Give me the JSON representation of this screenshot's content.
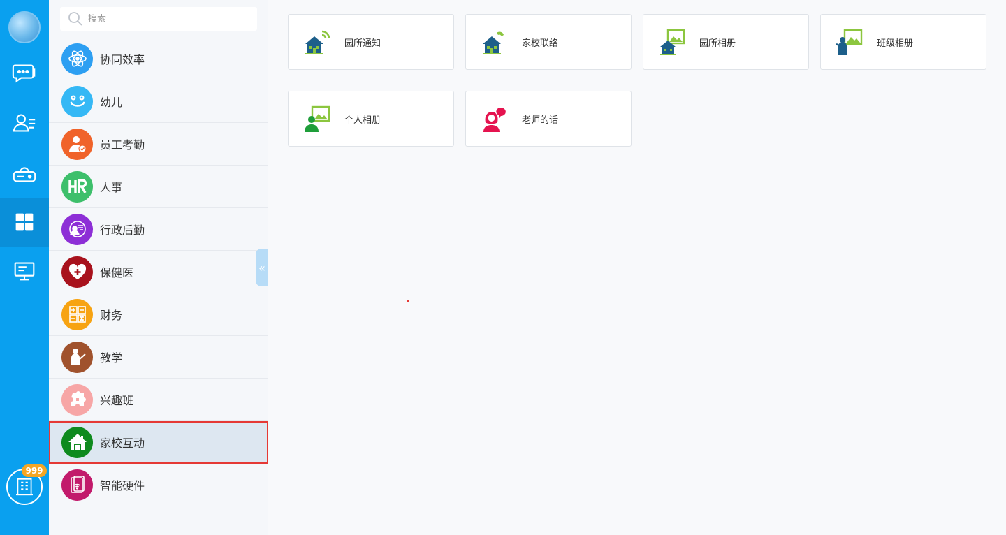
{
  "search": {
    "placeholder": "搜索"
  },
  "rail": {
    "badge": "999",
    "items": [
      {
        "name": "chat",
        "icon": "chat-bubbles-icon"
      },
      {
        "name": "contacts",
        "icon": "contacts-list-icon"
      },
      {
        "name": "cloud-disk",
        "icon": "cloud-drive-icon"
      },
      {
        "name": "apps",
        "icon": "app-grid-icon",
        "active": true
      },
      {
        "name": "display",
        "icon": "monitor-icon"
      }
    ]
  },
  "menu": {
    "items": [
      {
        "label": "协同效率",
        "icon": "atom-icon",
        "color": "#2d9ff2"
      },
      {
        "label": "幼儿",
        "icon": "smiley-face-icon",
        "color": "#35b8f5"
      },
      {
        "label": "员工考勤",
        "icon": "person-check-icon",
        "color": "#f0632a"
      },
      {
        "label": "人事",
        "icon": "hr-icon",
        "color": "#3dbf6b"
      },
      {
        "label": "行政后勤",
        "icon": "admin-person-icon",
        "color": "#8d2fd6"
      },
      {
        "label": "保健医",
        "icon": "heart-plus-icon",
        "color": "#a8121d"
      },
      {
        "label": "财务",
        "icon": "calculator-icon",
        "color": "#f7a312"
      },
      {
        "label": "教学",
        "icon": "teacher-icon",
        "color": "#a0522d"
      },
      {
        "label": "兴趣班",
        "icon": "puzzle-icon",
        "color": "#f7a6a6"
      },
      {
        "label": "家校互动",
        "icon": "house-icon",
        "color": "#0f8a1e",
        "selected": true
      },
      {
        "label": "智能硬件",
        "icon": "smart-device-icon",
        "color": "#c21a6b"
      }
    ]
  },
  "cards": [
    {
      "label": "园所通知",
      "icon": "school-notice-icon"
    },
    {
      "label": "家校联络",
      "icon": "home-school-contact-icon"
    },
    {
      "label": "园所相册",
      "icon": "school-album-icon"
    },
    {
      "label": "班级相册",
      "icon": "class-album-icon"
    },
    {
      "label": "个人相册",
      "icon": "personal-album-icon"
    },
    {
      "label": "老师的话",
      "icon": "teacher-message-icon"
    }
  ],
  "colors": {
    "rail": "#0aa0ef",
    "selected_outline": "#e53935",
    "badge": "#f5a623"
  }
}
